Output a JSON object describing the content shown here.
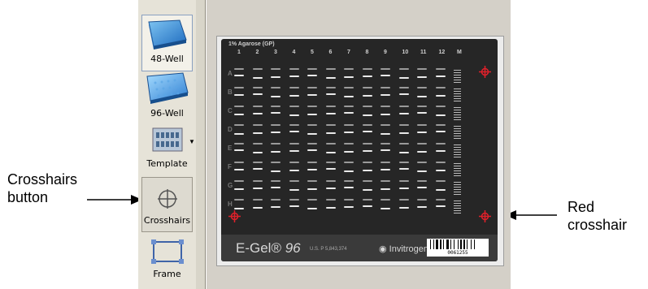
{
  "annotations": {
    "crosshairs_button": "Crosshairs\nbutton",
    "red_crosshair": "Red\ncrosshair"
  },
  "toolbar": {
    "items": [
      {
        "label": "48-Well",
        "icon": "48-well-plate-icon",
        "state": "selected"
      },
      {
        "label": "96-Well",
        "icon": "96-well-plate-icon",
        "state": "normal"
      },
      {
        "label": "Template",
        "icon": "template-icon",
        "state": "normal",
        "has_dropdown": true
      },
      {
        "label": "Crosshairs",
        "icon": "crosshairs-icon",
        "state": "pressed"
      },
      {
        "label": "Frame",
        "icon": "frame-icon",
        "state": "normal"
      }
    ]
  },
  "gel": {
    "header": "1% Agarose (GP)",
    "lanes": [
      "1",
      "2",
      "3",
      "4",
      "5",
      "6",
      "7",
      "8",
      "9",
      "10",
      "11",
      "12",
      "M"
    ],
    "rows": [
      "A",
      "B",
      "C",
      "D",
      "E",
      "F",
      "G",
      "H"
    ],
    "brand": "E-Gel",
    "brand_suffix": "96",
    "patent": "U.S. P 5,843,374",
    "vendor": "Invitrogen",
    "barcode_number": "0061255",
    "crosshair_color": "#e0202a"
  }
}
